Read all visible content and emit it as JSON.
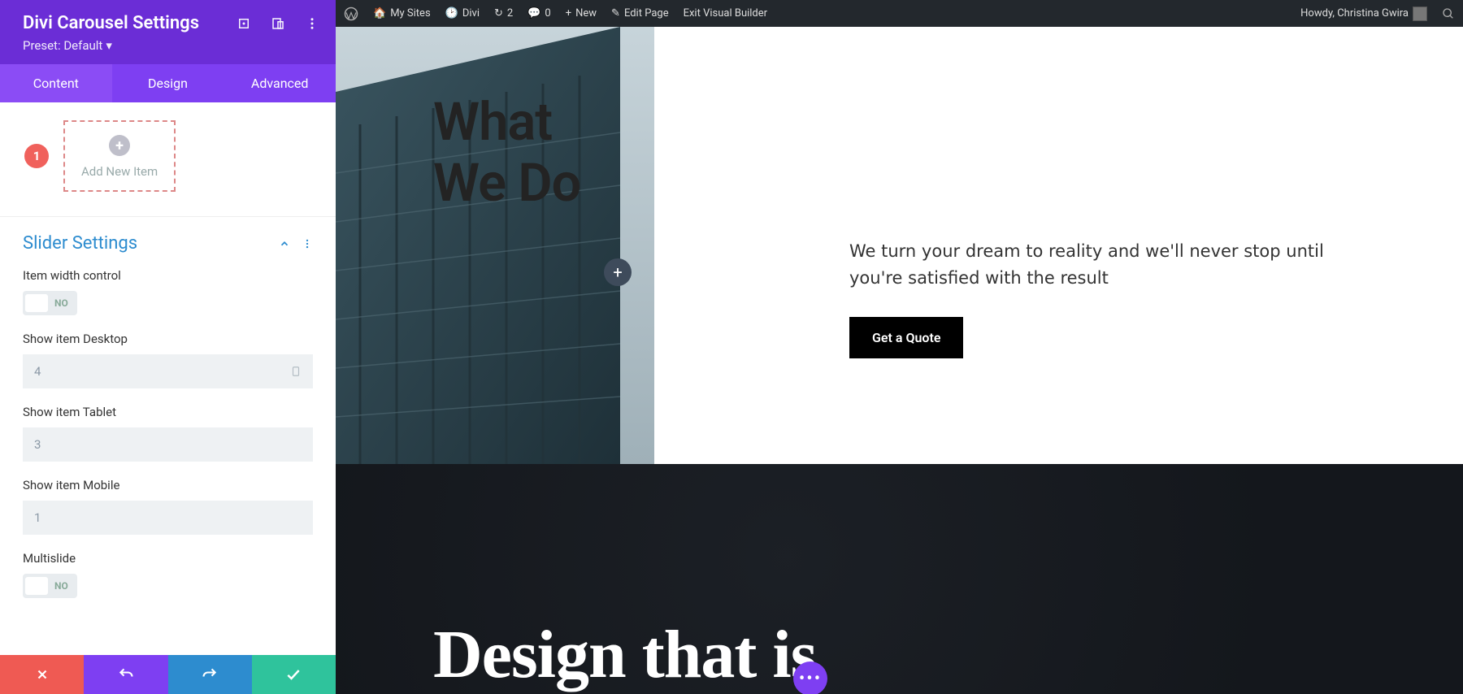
{
  "sidebar": {
    "title": "Divi Carousel Settings",
    "preset": "Preset: Default",
    "tabs": {
      "content": "Content",
      "design": "Design",
      "advanced": "Advanced"
    },
    "add_new_item": "Add New Item",
    "badge": "1",
    "group": {
      "title": "Slider Settings"
    },
    "fields": {
      "item_width_control": {
        "label": "Item width control",
        "value": "NO"
      },
      "show_desktop": {
        "label": "Show item Desktop",
        "value": "4"
      },
      "show_tablet": {
        "label": "Show item Tablet",
        "value": "3"
      },
      "show_mobile": {
        "label": "Show item Mobile",
        "value": "1"
      },
      "multislide": {
        "label": "Multislide",
        "value": "NO"
      }
    }
  },
  "adminbar": {
    "my_sites": "My Sites",
    "site": "Divi",
    "updates": "2",
    "comments": "0",
    "new": "New",
    "edit": "Edit Page",
    "exit": "Exit Visual Builder",
    "howdy": "Howdy, Christina Gwira"
  },
  "page": {
    "heading_line1": "What",
    "heading_line2": "We Do",
    "para": "We turn your dream to reality and we'll never stop until you're satisfied with the result",
    "cta": "Get a Quote",
    "band": "Design that is"
  }
}
